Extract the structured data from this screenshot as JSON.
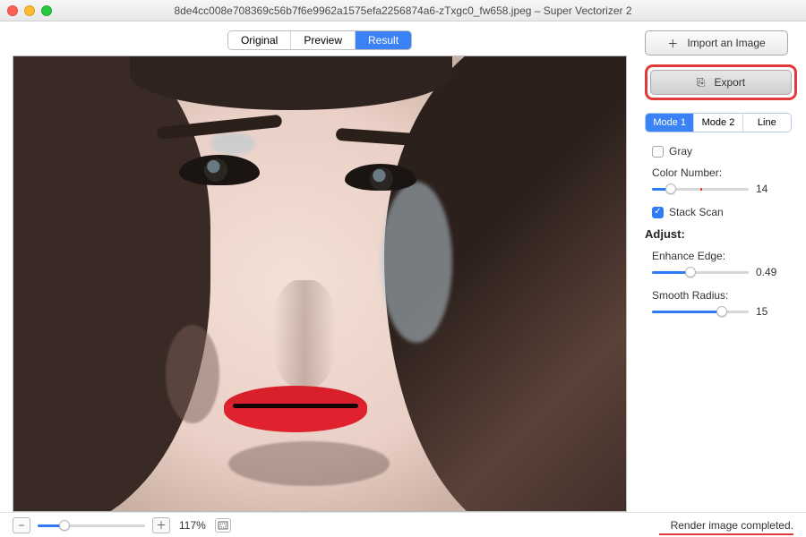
{
  "window": {
    "title": "8de4cc008e708369c56b7f6e9962a1575efa2256874a6-zTxgc0_fw658.jpeg – Super Vectorizer 2"
  },
  "view_tabs": {
    "original": "Original",
    "preview": "Preview",
    "result": "Result",
    "active": "result"
  },
  "sidebar": {
    "import_label": "Import an Image",
    "export_label": "Export",
    "modes": {
      "mode1": "Mode 1",
      "mode2": "Mode 2",
      "line": "Line",
      "active": "mode1"
    },
    "gray": {
      "label": "Gray",
      "checked": false
    },
    "color_number": {
      "label": "Color Number:",
      "value": 14,
      "min": 2,
      "max": 64,
      "mark": 32,
      "pos_pct": 19
    },
    "stack_scan": {
      "label": "Stack Scan",
      "checked": true
    },
    "adjust_label": "Adjust:",
    "enhance_edge": {
      "label": "Enhance Edge:",
      "value": "0.49",
      "pos_pct": 40
    },
    "smooth_radius": {
      "label": "Smooth Radius:",
      "value": 15,
      "pos_pct": 72
    }
  },
  "footer": {
    "zoom_pct": "117%",
    "status": "Render image completed."
  },
  "icons": {
    "plus": "＋",
    "export": "⎘",
    "minus": "−",
    "plus_small": "＋"
  },
  "colors": {
    "accent": "#3b82f6",
    "highlight_border": "#e13a3a"
  }
}
